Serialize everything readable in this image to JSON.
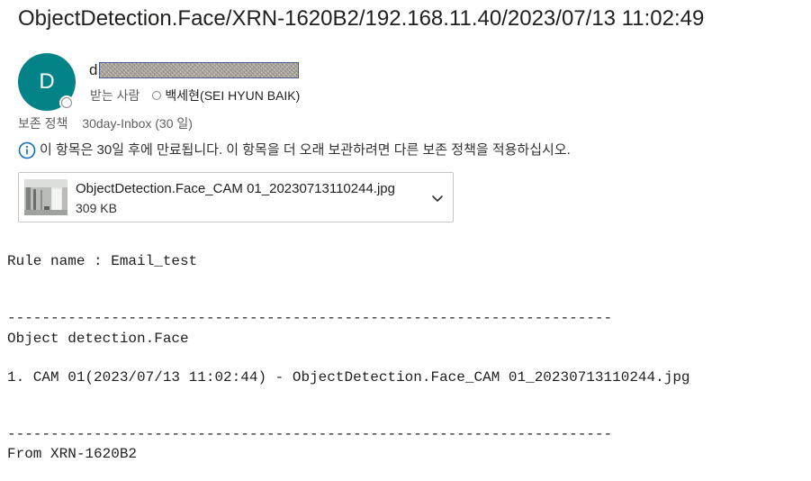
{
  "email": {
    "subject": "ObjectDetection.Face/XRN-1620B2/192.168.11.40/2023/07/13  11:02:49",
    "sender": {
      "avatar_initial": "D",
      "name_visible": "d",
      "avatar_color": "#038387"
    },
    "recipients": {
      "label": "받는 사람",
      "name": "백세현(SEI HYUN BAIK)"
    },
    "retention": {
      "label": "보존 정책",
      "value": "30day-Inbox (30 일)"
    },
    "expiry_notice": "이 항목은 30일 후에 만료됩니다. 이 항목을 더 오래 보관하려면 다른 보존 정책을 적용하십시오.",
    "attachment": {
      "filename": "ObjectDetection.Face_CAM 01_20230713110244.jpg",
      "size": "309 KB",
      "icon": "chevron-down-icon"
    },
    "body": {
      "rule_line": "Rule name : Email_test",
      "separator_1": "----------------------------------------------------------------------",
      "detection_type": "Object detection.Face",
      "detection_item": "1. CAM 01(2023/07/13 11:02:44) - ObjectDetection.Face_CAM 01_20230713110244.jpg",
      "separator_2": "----------------------------------------------------------------------",
      "from_line": "From XRN-1620B2"
    }
  }
}
